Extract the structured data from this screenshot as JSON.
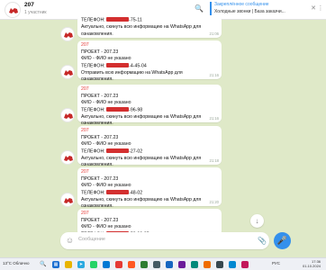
{
  "chat": {
    "title": "207",
    "subtitle": "1 участник"
  },
  "pinned": {
    "label": "Закреплённое сообщение",
    "text": "Холодные звонки | База заказчи..."
  },
  "messages": [
    {
      "sender": "",
      "lines": [
        "ТЕЛЕФОН: ██████-75-11",
        "Актуально, скинуть всю информацию на WhatsApp для",
        "ознакомления."
      ],
      "time": "21:06"
    },
    {
      "sender": "207",
      "lines": [
        "ПРОЕКТ - 207.23",
        "ФИО - ФИО не указано",
        "ТЕЛЕФОН: ██████-4-45-04",
        "Отправить всю информацию на WhatsApp для",
        "ознакомления."
      ],
      "time": "21:16"
    },
    {
      "sender": "207",
      "lines": [
        "ПРОЕКТ - 207.23",
        "ФИО - ФИО не указано",
        "ТЕЛЕФОН: ██████-96-98",
        "Актуально, скинуть всю информацию на WhatsApp для",
        "ознакомления."
      ],
      "time": "21:16"
    },
    {
      "sender": "207",
      "lines": [
        "ПРОЕКТ - 207.23",
        "ФИО - ФИО не указано",
        "ТЕЛЕФОН: ██████-27-02",
        "Актуально, скинуть всю информацию на WhatsApp для",
        "ознакомления."
      ],
      "time": "21:18"
    },
    {
      "sender": "207",
      "lines": [
        "ПРОЕКТ - 207.23",
        "ФИО - ФИО не указано",
        "ТЕЛЕФОН: ██████-48-02",
        "Актуально, скинуть всю информацию на WhatsApp для",
        "ознакомления."
      ],
      "time": "21:20"
    },
    {
      "sender": "207",
      "lines": [
        "ПРОЕКТ - 207.23",
        "ФИО - ФИО не указано",
        "ТЕЛЕФОН: ██████-53-90-85",
        "Актуально, скинуть всю информацию на WhatsApp для"
      ],
      "time": ""
    }
  ],
  "composer": {
    "placeholder": "Сообщение"
  },
  "taskbar": {
    "weather": "13°C Облачно",
    "lang": "РУС",
    "time": "17:36",
    "date": "01.10.2024"
  },
  "colors": {
    "background": "#dfe9c8",
    "accent": "#3390ec",
    "sender": "#e53935",
    "redaction": "#d32f2f"
  },
  "icons": {
    "search": "search-icon",
    "close": "close-icon",
    "more": "more-icon",
    "emoji": "emoji-icon",
    "attach": "attach-icon",
    "mic": "mic-icon",
    "scroll": "arrow-down-icon"
  }
}
